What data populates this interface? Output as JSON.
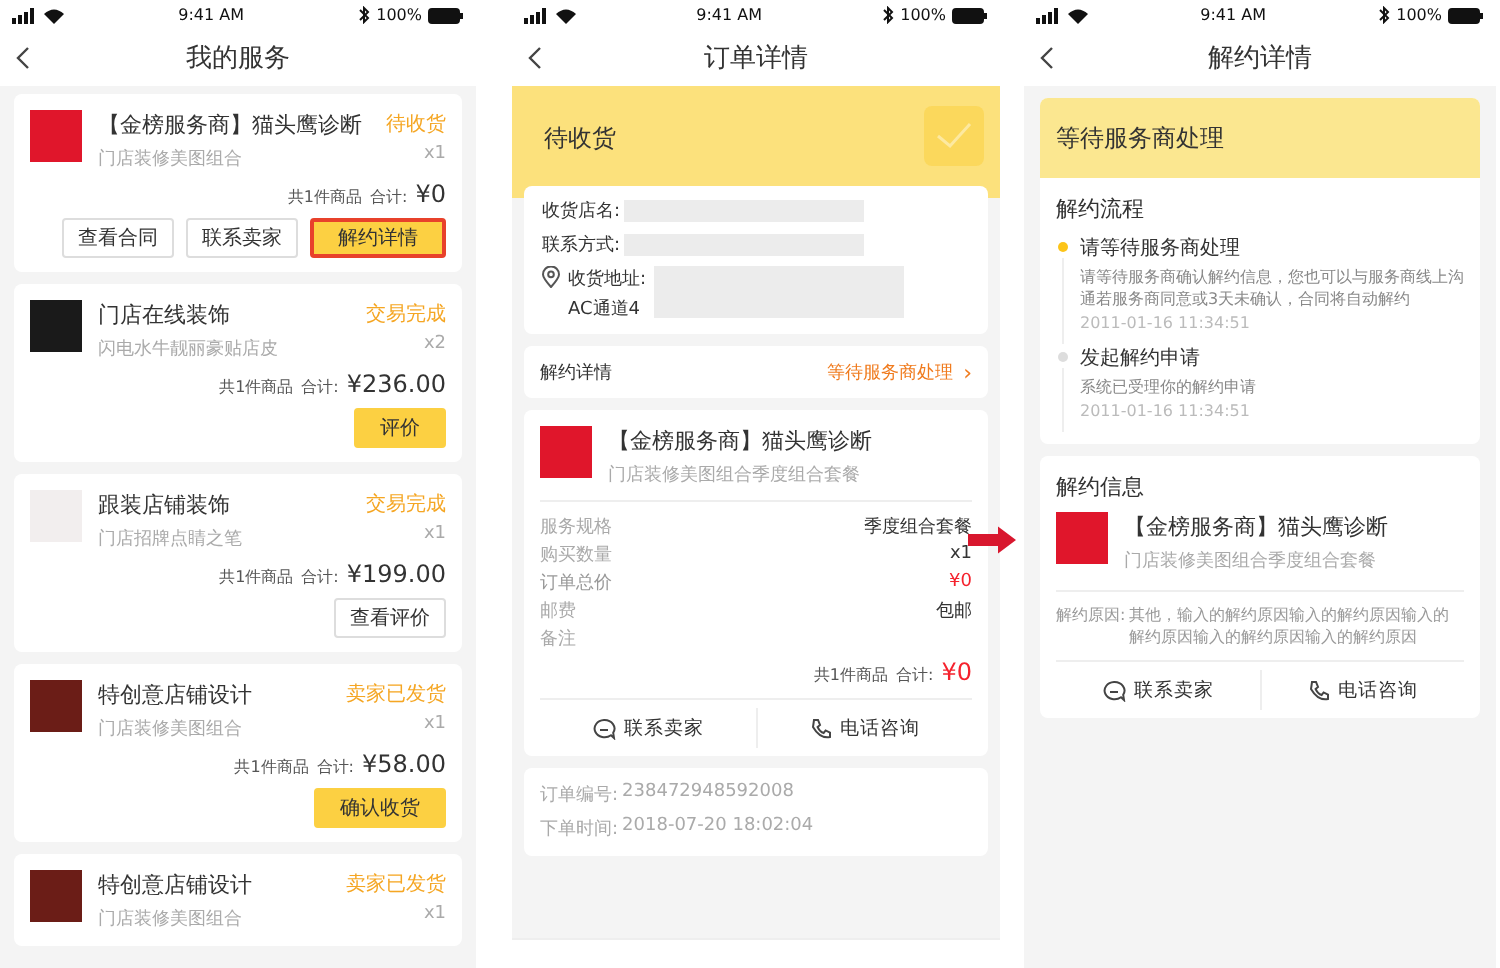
{
  "my_services": {
    "status_bar": {
      "time": "9:41 AM",
      "battery": "100%"
    },
    "title": "我的服务",
    "orders": [
      {
        "name": "【金榜服务商】猫头鹰诊断",
        "subtitle": "门店装修美图组合",
        "status": "待收货",
        "qty": "x1",
        "count": "共1件商品",
        "total_label": "合计:",
        "price": "¥0",
        "color": "#e0162b",
        "buttons": [
          {
            "label": "查看合同",
            "kind": "outline",
            "highlighted": false
          },
          {
            "label": "联系卖家",
            "kind": "outline",
            "highlighted": false
          },
          {
            "label": "解约详情",
            "kind": "primary",
            "highlighted": true
          }
        ]
      },
      {
        "name": "门店在线装饰",
        "subtitle": "闪电水牛靓丽豪贴店皮",
        "status": "交易完成",
        "qty": "x2",
        "count": "共1件商品",
        "total_label": "合计:",
        "price": "¥236.00",
        "color": "#1a1a1a",
        "buttons": [
          {
            "label": "评价",
            "kind": "primary",
            "highlighted": false
          }
        ]
      },
      {
        "name": "跟装店铺装饰",
        "subtitle": "门店招牌点睛之笔",
        "status": "交易完成",
        "qty": "x1",
        "count": "共1件商品",
        "total_label": "合计:",
        "price": "¥199.00",
        "color": "#f2eeee",
        "buttons": [
          {
            "label": "查看评价",
            "kind": "outline",
            "highlighted": false
          }
        ]
      },
      {
        "name": "特创意店铺设计",
        "subtitle": "门店装修美图组合",
        "status": "卖家已发货",
        "qty": "x1",
        "count": "共1件商品",
        "total_label": "合计:",
        "price": "¥58.00",
        "color": "#6b1d17",
        "buttons": [
          {
            "label": "确认收货",
            "kind": "primary",
            "highlighted": false
          }
        ]
      },
      {
        "name": "特创意店铺设计",
        "subtitle": "门店装修美图组合",
        "status": "卖家已发货",
        "qty": "x1",
        "color": "#6b1d17"
      }
    ]
  },
  "order_detail": {
    "status_bar": {
      "time": "9:41 AM",
      "battery": "100%"
    },
    "title": "订单详情",
    "banner": "待收货",
    "address": {
      "shop_label": "收货店名:",
      "contact_label": "联系方式:",
      "address_label": "收货地址:",
      "address_line_2": "AC通道4"
    },
    "cancel_row": {
      "label": "解约详情",
      "status": "等待服务商处理",
      "chevron": "›"
    },
    "product": {
      "name": "【金榜服务商】猫头鹰诊断",
      "subtitle": "门店装修美图组合季度组合套餐",
      "rows": [
        {
          "label": "服务规格",
          "value": "季度组合套餐",
          "kind": "plain"
        },
        {
          "label": "购买数量",
          "value": "x1",
          "kind": "plain"
        },
        {
          "label": "订单总价",
          "value": "¥0",
          "kind": "price"
        },
        {
          "label": "邮费",
          "value": "包邮",
          "kind": "plain"
        },
        {
          "label": "备注",
          "kind": "plain"
        }
      ],
      "count": "共1件商品",
      "total_label": "合计:",
      "price": "¥0"
    },
    "actions": [
      "联系卖家",
      "电话咨询"
    ],
    "info": [
      {
        "label": "订单编号:",
        "value": "238472948592008"
      },
      {
        "label": "下单时间:",
        "value": "2018-07-20 18:02:04"
      }
    ]
  },
  "cancel_detail": {
    "status_bar": {
      "time": "9:41 AM",
      "battery": "100%"
    },
    "title": "解约详情",
    "banner": "等待服务商处理",
    "process_title": "解约流程",
    "steps": [
      {
        "title": "请等待服务商处理",
        "desc": "请等待服务商确认解约信息，您也可以与服务商线上沟通若服务商同意或3天未确认，合同将自动解约",
        "time": "2011-01-16 11:34:51",
        "active": true
      },
      {
        "title": "发起解约申请",
        "desc": "系统已受理你的解约申请",
        "time": "2011-01-16 11:34:51",
        "active": false
      }
    ],
    "info_title": "解约信息",
    "product": {
      "name": "【金榜服务商】猫头鹰诊断",
      "subtitle": "门店装修美图组合季度组合套餐"
    },
    "reason_label": "解约原因:",
    "reason": "其他，输入的解约原因输入的解约原因输入的解约原因输入的解约原因输入的解约原因",
    "actions": [
      "联系卖家",
      "电话咨询"
    ]
  }
}
